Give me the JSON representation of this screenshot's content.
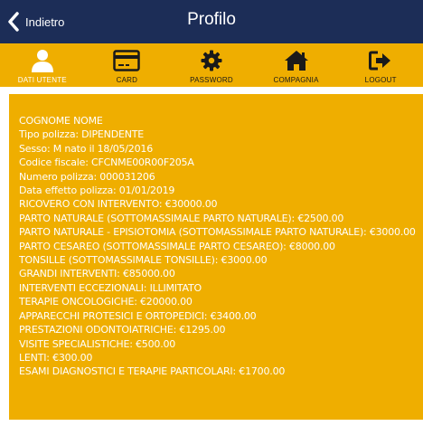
{
  "header": {
    "back_label": "Indietro",
    "title": "Profilo"
  },
  "tabs": [
    {
      "label": "DATI UTENTE",
      "icon": "user-icon",
      "active": true
    },
    {
      "label": "CARD",
      "icon": "card-icon",
      "active": false
    },
    {
      "label": "PASSWORD",
      "icon": "gear-icon",
      "active": false
    },
    {
      "label": "COMPAGNIA",
      "icon": "home-icon",
      "active": false
    },
    {
      "label": "LOGOUT",
      "icon": "logout-icon",
      "active": false
    }
  ],
  "profile": {
    "lines": [
      "COGNOME NOME",
      "Tipo polizza: DIPENDENTE",
      "Sesso: M nato il 18/05/2016",
      "Codice fiscale: CFCNME00R00F205A",
      "Numero polizza: 000031206",
      "Data effetto polizza: 01/01/2019",
      "RICOVERO CON INTERVENTO: €30000.00",
      "PARTO NATURALE (SOTTOMASSIMALE PARTO NATURALE): €2500.00",
      "PARTO NATURALE - EPISIOTOMIA (SOTTOMASSIMALE PARTO NATURALE): €3000.00",
      "PARTO CESAREO (SOTTOMASSIMALE PARTO CESAREO): €8000.00",
      "TONSILLE (SOTTOMASSIMALE TONSILLE): €3000.00",
      "GRANDI INTERVENTI: €85000.00",
      "INTERVENTI ECCEZIONALI: ILLIMITATO",
      "TERAPIE ONCOLOGICHE: €20000.00",
      "APPARECCHI PROTESICI E ORTOPEDICI: €3400.00",
      "PRESTAZIONI ODONTOIATRICHE: €1295.00",
      "VISITE SPECIALISTICHE: €500.00",
      "LENTI: €300.00",
      "ESAMI DIAGNOSTICI E TERAPIE PARTICOLARI: €1700.00"
    ]
  },
  "colors": {
    "header_bg": "#1c2d57",
    "accent": "#efae00",
    "text_light": "#ffffff"
  }
}
